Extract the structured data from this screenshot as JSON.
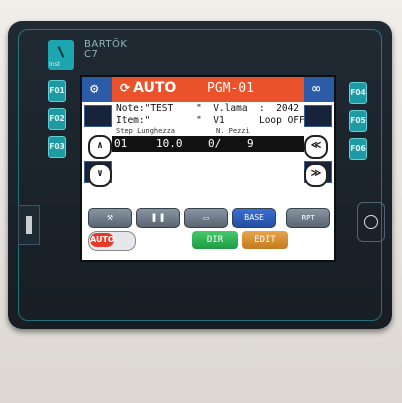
{
  "brand": {
    "name": "BARTÖK",
    "model": "C7",
    "logo_text": "Inst"
  },
  "fkeys_left": [
    "F01",
    "F02",
    "F03"
  ],
  "fkeys_right": [
    "F04",
    "F05",
    "F06"
  ],
  "header": {
    "mode": "AUTO",
    "mode_icon": "refresh-icon",
    "program": "PGM-01",
    "left_icon": "faucet-icon",
    "right_icon": "loop-icon"
  },
  "info": {
    "line1": "Note:\"TEST    \"  V.lama  :  2042",
    "line2": "Item:\"        \"  V1      Loop OFF"
  },
  "table": {
    "col1": "Step Lunghezza",
    "col2": "N. Pezzi",
    "step": "01",
    "length": "10.0",
    "pieces": "0/",
    "total": "9"
  },
  "toolbar": {
    "btn1_icon": "tool-icon",
    "btn2_icon": "pause-icon",
    "btn3_icon": "frame-icon",
    "base": "BASE",
    "rpt": "RPT"
  },
  "bottom": {
    "auto": "AUTO",
    "dir": "DIR",
    "edit": "EDIT"
  },
  "colors": {
    "accent": "#e9522a",
    "teal": "#1ea6b0",
    "blue": "#2c5ba8"
  }
}
